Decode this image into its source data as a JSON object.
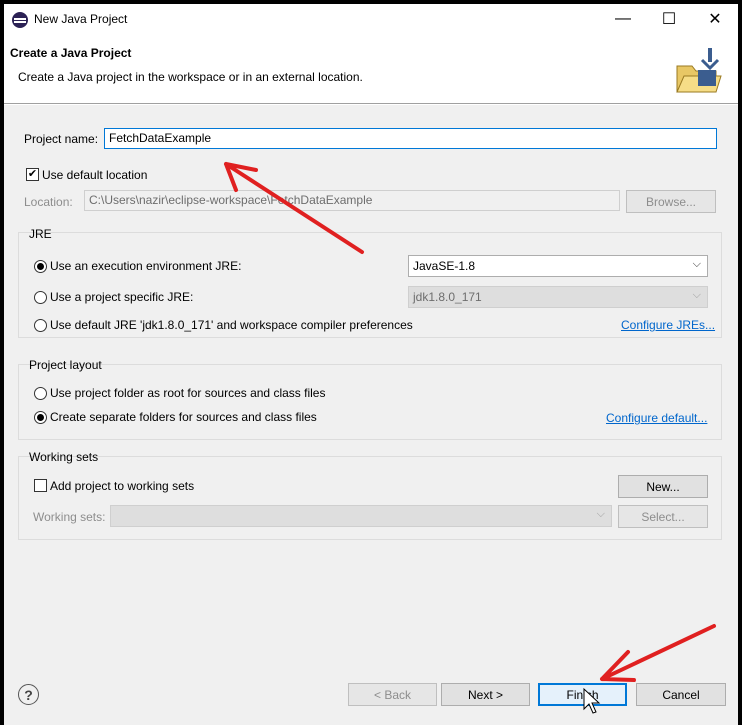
{
  "window": {
    "title": "New Java Project",
    "minimize": "—",
    "maximize": "☐",
    "close": "✕"
  },
  "header": {
    "title": "Create a Java Project",
    "description": "Create a Java project in the workspace or in an external location."
  },
  "project": {
    "name_label": "Project name:",
    "name_value": "FetchDataExample",
    "use_default_label": "Use default location",
    "use_default_checked": true,
    "location_label": "Location:",
    "location_value": "C:\\Users\\nazir\\eclipse-workspace\\FetchDataExample",
    "browse_label": "Browse..."
  },
  "jre": {
    "group_title": "JRE",
    "option1_label": "Use an execution environment JRE:",
    "option1_value": "JavaSE-1.8",
    "option2_label": "Use a project specific JRE:",
    "option2_value": "jdk1.8.0_171",
    "option3_label": "Use default JRE 'jdk1.8.0_171' and workspace compiler preferences",
    "configure_link": "Configure JREs..."
  },
  "layout": {
    "group_title": "Project layout",
    "option1_label": "Use project folder as root for sources and class files",
    "option2_label": "Create separate folders for sources and class files",
    "configure_link": "Configure default..."
  },
  "working_sets": {
    "group_title": "Working sets",
    "add_label": "Add project to working sets",
    "new_label": "New...",
    "sets_label": "Working sets:",
    "select_label": "Select..."
  },
  "footer": {
    "help": "?",
    "back_label": "< Back",
    "next_label": "Next >",
    "finish_label": "Finish",
    "cancel_label": "Cancel"
  },
  "colors": {
    "annotation_arrow": "#e02020",
    "link": "#0066cc",
    "focus_border": "#0078d7"
  }
}
